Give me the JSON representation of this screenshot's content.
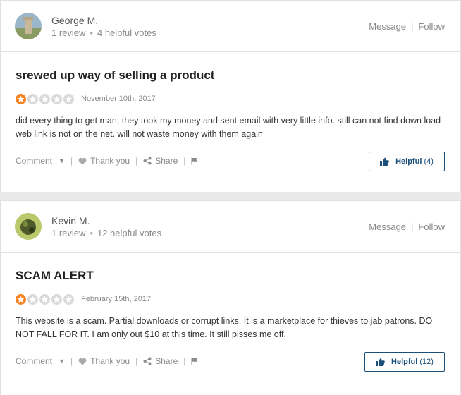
{
  "reviews": [
    {
      "user": {
        "name": "George M.",
        "reviews": "1 review",
        "votes": "4 helpful votes"
      },
      "user_actions": {
        "message": "Message",
        "follow": "Follow"
      },
      "title": "srewed up way of selling a product",
      "rating": 1,
      "date": "November 10th, 2017",
      "body": "did every thing to get man, they took my money and sent email with very little info. still can not find down load web link is not on the net. will not waste money with them again",
      "actions": {
        "comment": "Comment",
        "thank": "Thank you",
        "share": "Share"
      },
      "helpful": {
        "label": "Helpful",
        "count": "(4)"
      }
    },
    {
      "user": {
        "name": "Kevin M.",
        "reviews": "1 review",
        "votes": "12 helpful votes"
      },
      "user_actions": {
        "message": "Message",
        "follow": "Follow"
      },
      "title": "SCAM ALERT",
      "rating": 1,
      "date": "February 15th, 2017",
      "body": "This website is a scam. Partial downloads or corrupt links. It is a marketplace for thieves to jab patrons. DO NOT FALL FOR IT. I am only out $10 at this time. It still pisses me off.",
      "actions": {
        "comment": "Comment",
        "thank": "Thank you",
        "share": "Share"
      },
      "helpful": {
        "label": "Helpful",
        "count": "(12)"
      }
    }
  ],
  "colors": {
    "star_on": "#f7831f",
    "star_off": "#d9d9d9",
    "helpful_blue": "#1b4f7a"
  },
  "icons": {
    "rating": "star-icon",
    "thank": "heart-icon",
    "share": "share-icon",
    "flag": "flag-icon",
    "helpful": "thumbs-up-icon",
    "comment": "caret-down-icon"
  }
}
